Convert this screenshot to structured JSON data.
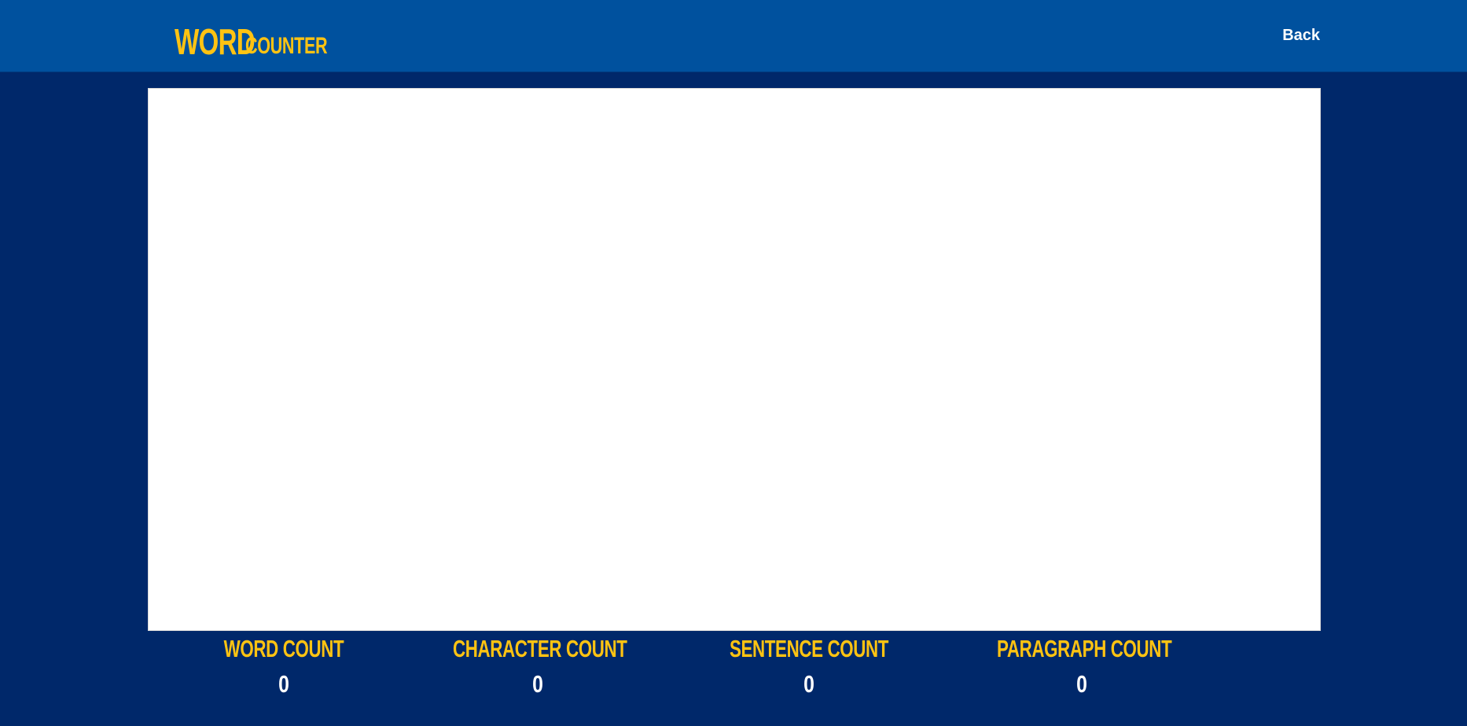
{
  "header": {
    "logo_word": "WORD",
    "logo_counter": "COUNTER",
    "back_label": "Back"
  },
  "editor": {
    "value": "",
    "placeholder": ""
  },
  "stats": [
    {
      "label": "WORD COUNT",
      "value": "0"
    },
    {
      "label": "CHARACTER COUNT",
      "value": "0"
    },
    {
      "label": "SENTENCE COUNT",
      "value": "0"
    },
    {
      "label": "PARAGRAPH COUNT",
      "value": "0"
    }
  ],
  "colors": {
    "page_background": "#00286a",
    "header_background": "#00519e",
    "accent_yellow": "#ffc312",
    "text_white": "#ffffff"
  }
}
